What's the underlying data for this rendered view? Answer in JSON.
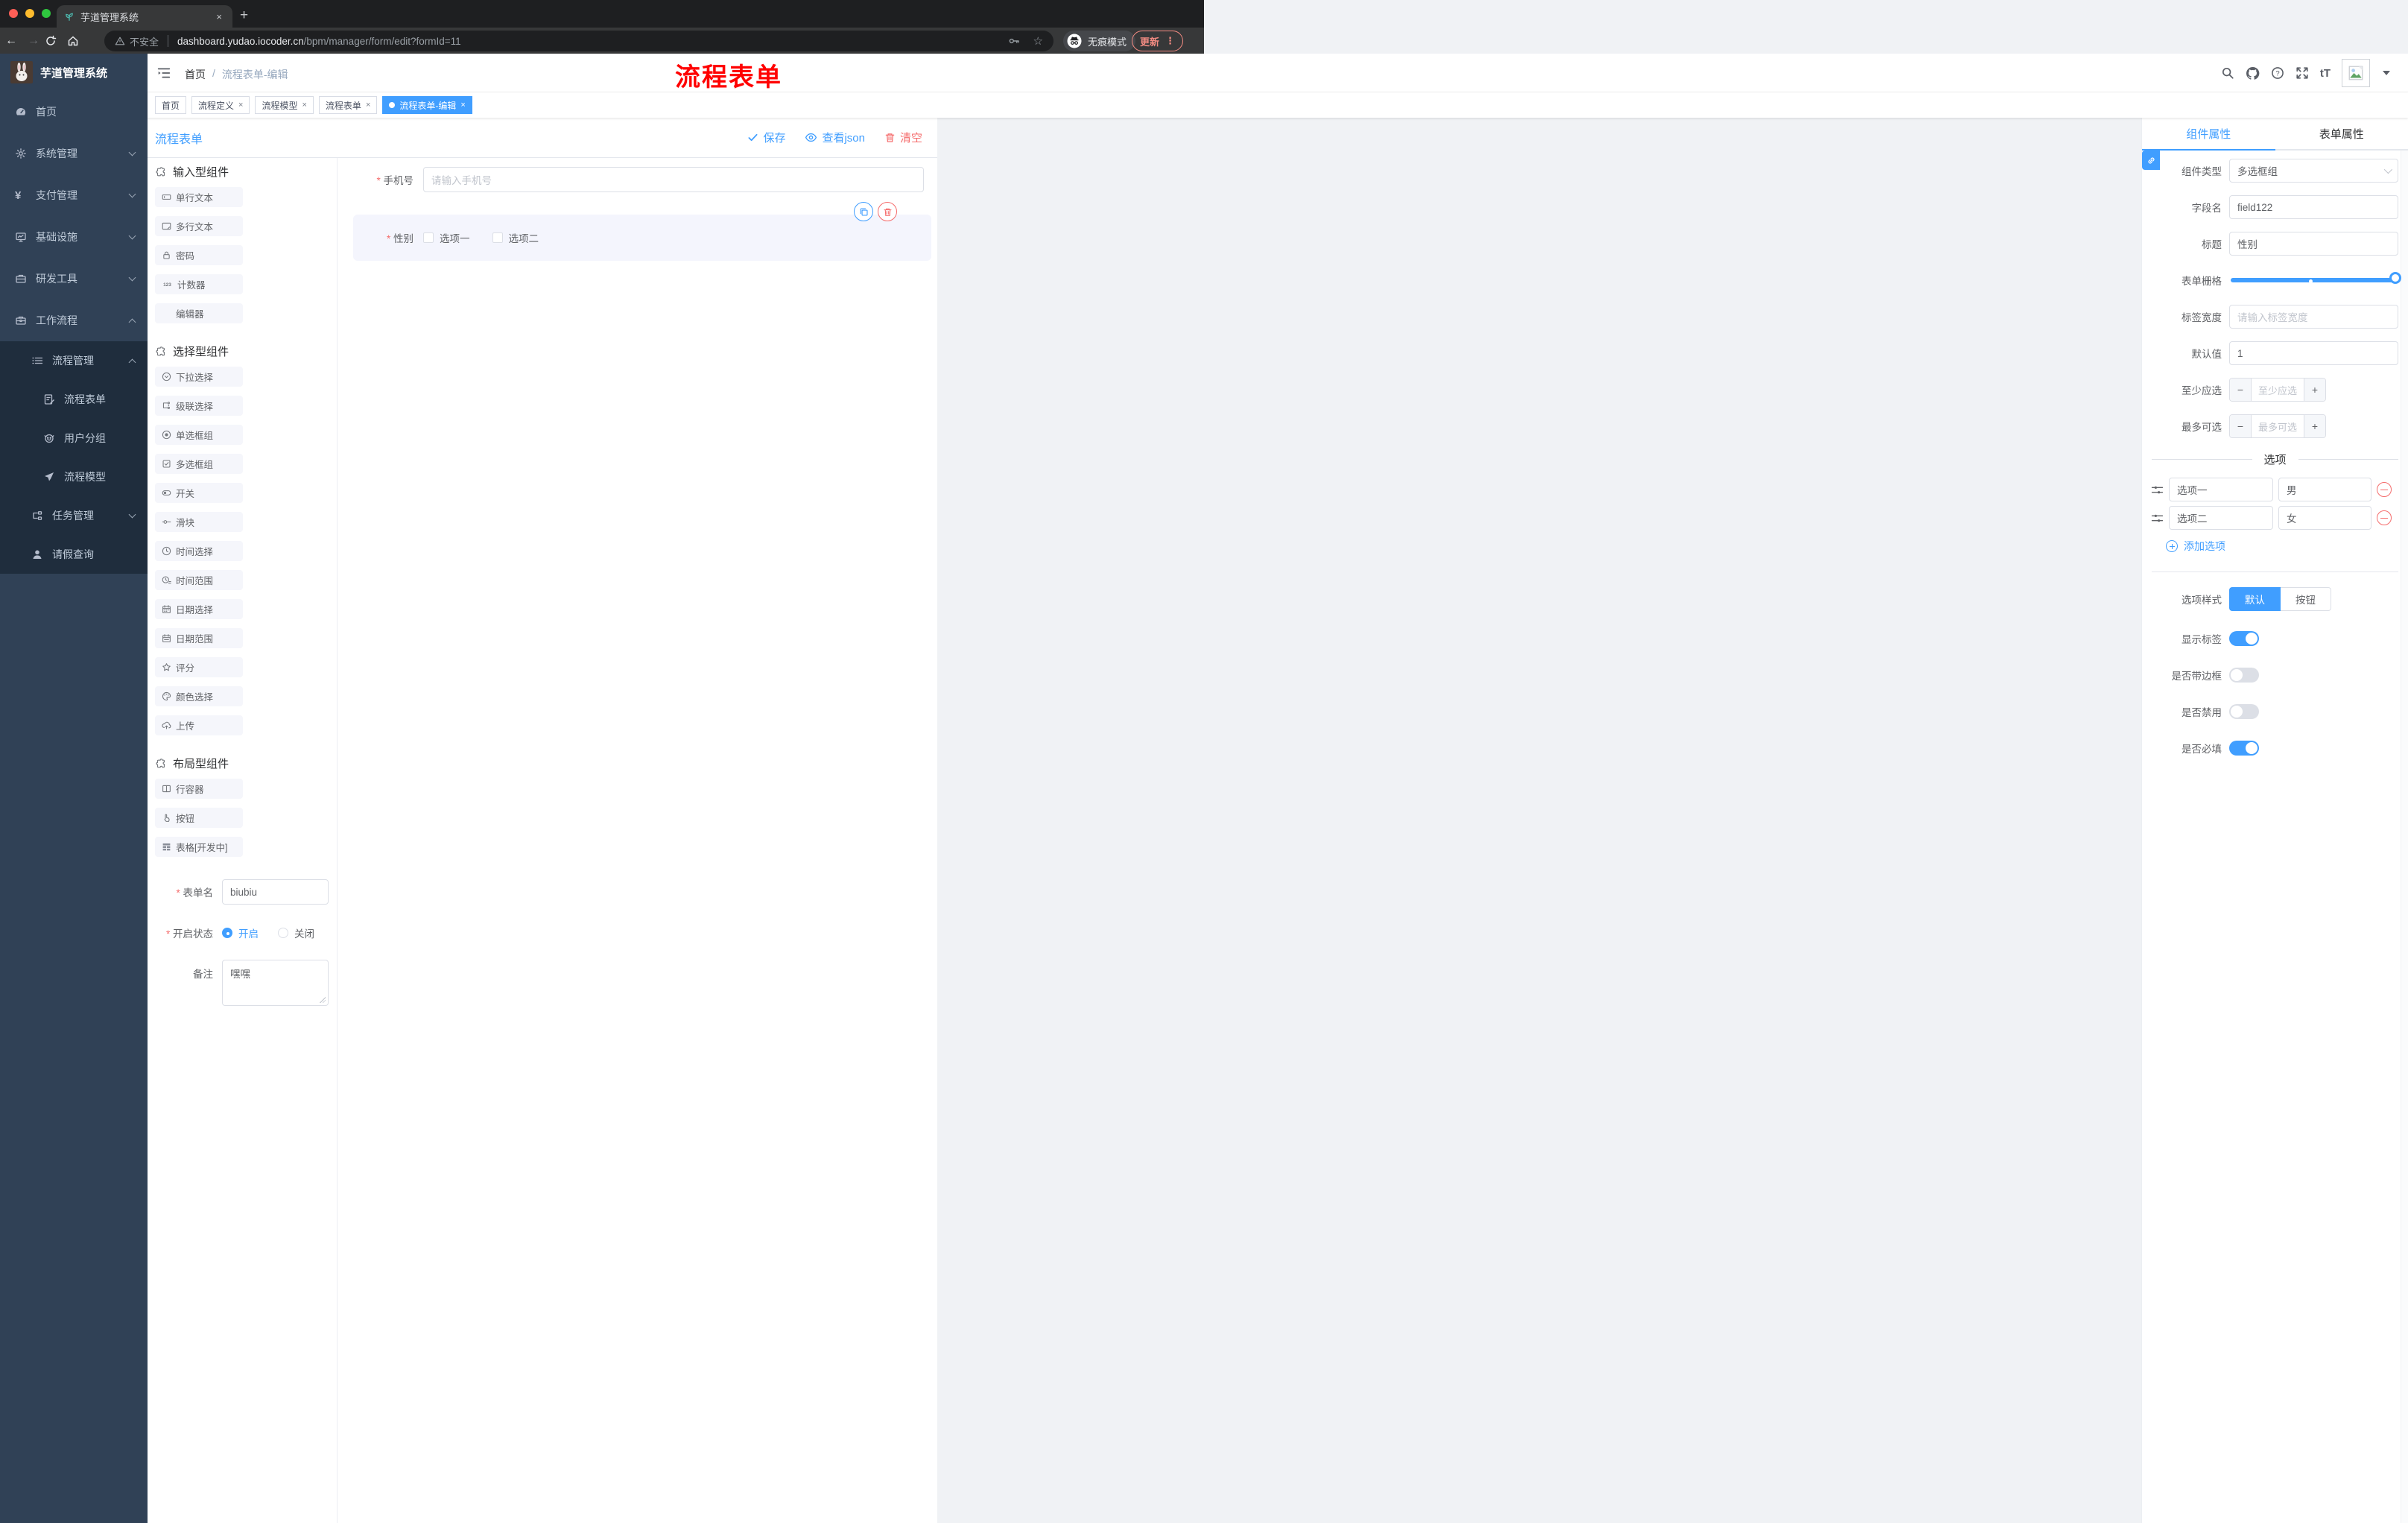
{
  "colors": {
    "accent": "#409EFF",
    "danger": "#F56C6C",
    "sidebar_bg": "#304156",
    "sidebar_sub_bg": "#1F2D3D",
    "annotation_red": "#FF0000",
    "update_salmon": "#F28B82"
  },
  "browser": {
    "tab_title": "芋道管理系统",
    "close_glyph": "×",
    "newtab_glyph": "+",
    "back_glyph": "←",
    "forward_glyph": "→",
    "security_label": "不安全",
    "url_host": "dashboard.yudao.iocoder.cn",
    "url_path": "/bpm/manager/form/edit?formId=11",
    "star_glyph": "☆",
    "incognito_label": "无痕模式",
    "update_label": "更新",
    "dots_glyph": "⋮"
  },
  "sidebar": {
    "logo_title": "芋道管理系统",
    "items": [
      {
        "label": "首页"
      },
      {
        "label": "系统管理"
      },
      {
        "label": "支付管理"
      },
      {
        "label": "基础设施"
      },
      {
        "label": "研发工具"
      },
      {
        "label": "工作流程"
      },
      {
        "label": "流程管理"
      },
      {
        "label": "流程表单"
      },
      {
        "label": "用户分组"
      },
      {
        "label": "流程模型"
      },
      {
        "label": "任务管理"
      },
      {
        "label": "请假查询"
      }
    ],
    "yen_glyph": "¥"
  },
  "header": {
    "breadcrumb_home": "首页",
    "breadcrumb_sep": "/",
    "breadcrumb_current": "流程表单-编辑",
    "annotation": "流程表单",
    "question_glyph": "?",
    "textsize_glyph": "tT"
  },
  "tags": [
    {
      "label": "首页"
    },
    {
      "label": "流程定义",
      "close": "×"
    },
    {
      "label": "流程模型",
      "close": "×"
    },
    {
      "label": "流程表单",
      "close": "×"
    },
    {
      "label": "流程表单-编辑",
      "close": "×"
    }
  ],
  "designer": {
    "title": "流程表单",
    "save_label": "保存",
    "view_json_label": "查看json",
    "clear_label": "清空"
  },
  "palette": {
    "sections": [
      {
        "title": "输入型组件",
        "items": [
          {
            "label": "单行文本"
          },
          {
            "label": "多行文本"
          },
          {
            "label": "密码"
          },
          {
            "label": "计数器"
          },
          {
            "label": "编辑器"
          }
        ],
        "counter_glyph": "123"
      },
      {
        "title": "选择型组件",
        "items": [
          {
            "label": "下拉选择"
          },
          {
            "label": "级联选择"
          },
          {
            "label": "单选框组"
          },
          {
            "label": "多选框组"
          },
          {
            "label": "开关"
          },
          {
            "label": "滑块"
          },
          {
            "label": "时间选择"
          },
          {
            "label": "时间范围"
          },
          {
            "label": "日期选择"
          },
          {
            "label": "日期范围"
          },
          {
            "label": "评分"
          },
          {
            "label": "颜色选择"
          },
          {
            "label": "上传"
          }
        ]
      },
      {
        "title": "布局型组件",
        "items": [
          {
            "label": "行容器"
          },
          {
            "label": "按钮"
          },
          {
            "label": "表格[开发中]"
          }
        ]
      }
    ]
  },
  "form_meta": {
    "name_label": "表单名",
    "name_value": "biubiu",
    "status_label": "开启状态",
    "status_on": "开启",
    "status_off": "关闭",
    "remark_label": "备注",
    "remark_value": "嘿嘿"
  },
  "canvas": {
    "phone_label": "手机号",
    "phone_placeholder": "请输入手机号",
    "gender_label": "性别",
    "gender_option1": "选项一",
    "gender_option2": "选项二"
  },
  "inspector": {
    "tab_component": "组件属性",
    "tab_form": "表单属性",
    "type_label": "组件类型",
    "type_value": "多选框组",
    "field_label": "字段名",
    "field_value": "field122",
    "title_label": "标题",
    "title_value": "性别",
    "grid_label": "表单栅格",
    "grid": {
      "fill_percent": 100,
      "mark_percent": 47
    },
    "label_width_label": "标签宽度",
    "label_width_placeholder": "请输入标签宽度",
    "default_label": "默认值",
    "default_value": "1",
    "min_label": "至少应选",
    "min_placeholder": "至少应选",
    "max_label": "最多可选",
    "max_placeholder": "最多可选",
    "minus_glyph": "−",
    "plus_glyph": "+",
    "options_title": "选项",
    "options": [
      {
        "label": "选项一",
        "value": "男"
      },
      {
        "label": "选项二",
        "value": "女"
      }
    ],
    "add_option_label": "添加选项",
    "style_label": "选项样式",
    "style_default": "默认",
    "style_button": "按钮",
    "switch_show_label": "显示标签",
    "switch_border_label": "是否带边框",
    "switch_disabled_label": "是否禁用",
    "switch_required_label": "是否必填"
  }
}
